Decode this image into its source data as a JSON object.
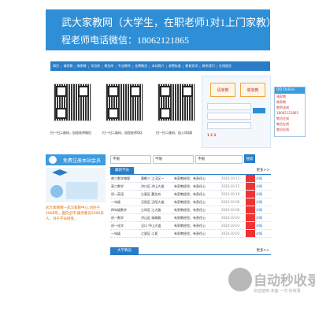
{
  "banner": {
    "line1": "武大家教网（大学生，在职老师1对1上门家教）",
    "line2": "程老师电话微信：18062121865"
  },
  "nav": [
    "网页",
    "请家教",
    "做家教",
    "学员库",
    "教员库",
    "专业教师",
    "金牌教员",
    "本站简介",
    "收费标准",
    "教育资讯",
    "联系我们",
    "在线留言"
  ],
  "qr": {
    "cap1": "扫一扫二维码，加程老师微信",
    "cap2": "扫一扫二维码，加程老师QQ",
    "cap3": "扫一扫二维码，加入QQ群"
  },
  "login": {
    "btn1": "请家教",
    "btn2": "做家教",
    "registered": "1 2 3"
  },
  "sidebar": {
    "title": "免费注册本站会员",
    "body": "武大家教网—武汉家教中心,创办于2008年，面向全市,服务教员5000多人，对于学员接受..."
  },
  "filter": {
    "sel1": "不限",
    "sel2": "不限",
    "sel3": "不限",
    "btn": "搜索"
  },
  "tabs": {
    "active": "最新学员",
    "more": "更多>>"
  },
  "rows": [
    {
      "c1": "南三数学物理",
      "c2": "黄鹤三 江汉区一",
      "c3": "有家教经验、有责任心",
      "date": "2024-10-12",
      "status": "详情"
    },
    {
      "c1": "高二数学",
      "c2": "洪口区 洪山大道",
      "c3": "有家教经验、有责任心",
      "date": "2024-10-12",
      "status": "详情"
    },
    {
      "c1": "初一英语",
      "c2": "江夏区 藏龙岛",
      "c3": "有家教经验、有责任心",
      "date": "2024-10-10",
      "status": "详情"
    },
    {
      "c1": "一年级",
      "c2": "汉阳区 汉阳大道",
      "c3": "有家教经验、有责任心",
      "date": "2024-10-06",
      "status": "详情"
    },
    {
      "c1": "四年级数学",
      "c2": "江岸区 江大路",
      "c3": "有家教经验、有责任心",
      "date": "2024-10-06",
      "status": "详情"
    },
    {
      "c1": "初一数学",
      "c2": "洪山区 珞瑜路",
      "c3": "有家教经验、有责任心",
      "date": "2024-10-03",
      "status": "详情"
    },
    {
      "c1": "初一化学",
      "c2": "汉口 中山大道",
      "c3": "有家教经验、有责任心",
      "date": "2024-10-03",
      "status": "详情"
    },
    {
      "c1": "一年级",
      "c2": "江夏区 江夏",
      "c3": "有家教经验、有责任心",
      "date": "2024-10-02",
      "status": "详情"
    }
  ],
  "section2": {
    "title": "大学教员",
    "more": "更多>>"
  },
  "qq": {
    "title": "QQ Online",
    "lines": [
      "请家教",
      "做家教",
      "教师咨询",
      "18062121865",
      "教员在线",
      "教员在线",
      "教员在线"
    ]
  },
  "watermark": {
    "name": "自动秒收录",
    "sub": "欢迎使用·未备·一次·秒收录"
  }
}
